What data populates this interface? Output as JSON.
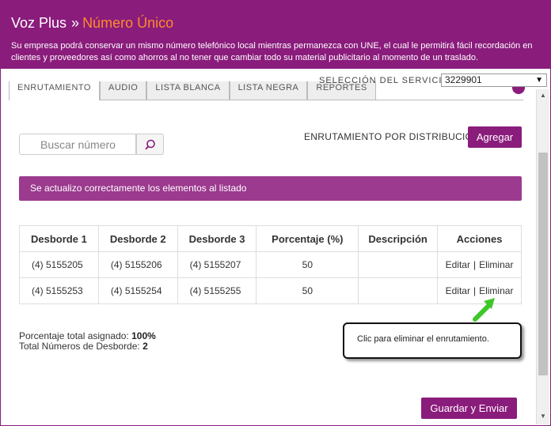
{
  "header": {
    "brand": "Voz Plus",
    "separator": "»",
    "product": "Número Único",
    "description": "Su empresa podrá conservar un mismo número telefónico local mientras permanezca con UNE, el cual le permitirá fácil recordación en clientes y proveedores así como ahorros al no tener que cambiar todo su material publicitario al momento de un traslado."
  },
  "service": {
    "label": "SELECCIÓN DEL SERVICIO:",
    "selected": "3229901"
  },
  "tabs": [
    {
      "label": "ENRUTAMIENTO",
      "active": true
    },
    {
      "label": "AUDIO",
      "active": false
    },
    {
      "label": "LISTA BLANCA",
      "active": false
    },
    {
      "label": "LISTA NEGRA",
      "active": false
    },
    {
      "label": "REPORTES",
      "active": false
    }
  ],
  "search": {
    "placeholder": "Buscar número"
  },
  "distribution": {
    "label": "ENRUTAMIENTO POR DISTRIBUCIÓN",
    "add_button": "Agregar"
  },
  "alert": {
    "message": "Se actualizo correctamente los elementos al listado"
  },
  "table": {
    "headers": [
      "Desborde 1",
      "Desborde 2",
      "Desborde 3",
      "Porcentaje (%)",
      "Descripción",
      "Acciones"
    ],
    "rows": [
      {
        "d1": "(4) 5155205",
        "d2": "(4) 5155206",
        "d3": "(4) 5155207",
        "pct": "50",
        "desc": "",
        "edit": "Editar",
        "sep": "|",
        "delete": "Eliminar"
      },
      {
        "d1": "(4) 5155253",
        "d2": "(4) 5155254",
        "d3": "(4) 5155255",
        "pct": "50",
        "desc": "",
        "edit": "Editar",
        "sep": "|",
        "delete": "Eliminar"
      }
    ]
  },
  "summary": {
    "pct_label": "Porcentaje total asignado:",
    "pct_value": "100%",
    "count_label": "Total Números de Desborde:",
    "count_value": "2"
  },
  "tooltip": {
    "text": "Clic para eliminar el enrutamiento."
  },
  "footer": {
    "save_button": "Guardar y Enviar"
  },
  "colors": {
    "brand_purple": "#8a1c7c",
    "alert_purple": "#9b3a8e",
    "accent_orange": "#ff8a2a",
    "arrow_green": "#3fc72a"
  },
  "icons": {
    "search": "search-icon",
    "pointer": "green-arrow-icon",
    "dropdown": "chevron-down-icon"
  }
}
